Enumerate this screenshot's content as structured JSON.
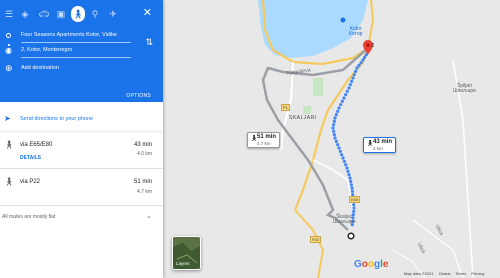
{
  "header": {
    "modes": [
      "menu-icon",
      "directions-icon",
      "car-icon",
      "transit-icon",
      "walk-icon",
      "bike-icon",
      "flight-icon"
    ],
    "origin": "Four Seasons Apartments Kotor, Vidike",
    "destination": "2, Kotor, Montenegro",
    "add_destination": "Add destination",
    "options_label": "OPTIONS"
  },
  "send_directions": "Send directions to your phone",
  "routes": [
    {
      "via": "via E65/E80",
      "duration": "43 min",
      "distance": "4.0 km",
      "details": "DETAILS"
    },
    {
      "via": "via P22",
      "duration": "51 min",
      "distance": "4.7 km"
    }
  ],
  "terrain_note": "All routes are mostly flat",
  "map": {
    "badge_fast": {
      "time": "43 min",
      "dist": "4 km"
    },
    "badge_slow": {
      "time": "51 min",
      "dist": "4.7 km"
    },
    "labels": {
      "kotor": "Kotor",
      "kotor_cyr": "Котор",
      "skaljari": "SKALJARI",
      "skaljari2": "Škaljari",
      "skaljari2_cyr": "Шкаљари",
      "spiljari": "Špiljari",
      "spiljari_cyr": "Шпиљари",
      "njegoseva": "Njegoševa",
      "road_p1": "P1",
      "road_p22": "P22",
      "road_e65": "E65",
      "dest_num": "2",
      "street_a": "Ulica",
      "street_b": "Ulica"
    },
    "layers_label": "Layers",
    "google": [
      "G",
      "o",
      "o",
      "g",
      "l",
      "e"
    ],
    "google_colors": [
      "#4285f4",
      "#ea4335",
      "#fbbc05",
      "#4285f4",
      "#34a853",
      "#ea4335"
    ],
    "footer": [
      "Map data ©2021",
      "Global",
      "Terms",
      "Privacy"
    ]
  },
  "colors": {
    "accent": "#1a73e8",
    "route_dots": "#4285f4",
    "alt_route": "#9aa0a6",
    "water": "#aadaff",
    "destination_pin": "#ea4335"
  }
}
